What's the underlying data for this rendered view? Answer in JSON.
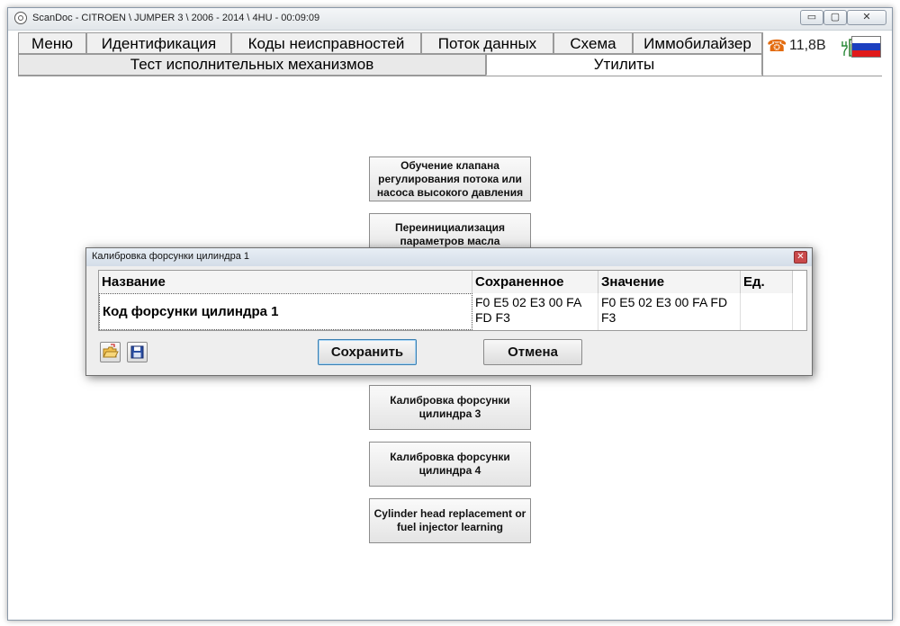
{
  "window": {
    "title": "ScanDoc - CITROEN \\ JUMPER 3 \\ 2006 - 2014 \\ 4HU - 00:09:09",
    "minimize": "▭",
    "maximize": "▢",
    "close": "✕"
  },
  "menu": [
    {
      "label": "Меню"
    },
    {
      "label": "Идентификация"
    },
    {
      "label": "Коды неисправностей"
    },
    {
      "label": "Поток данных"
    },
    {
      "label": "Схема"
    },
    {
      "label": "Иммобилайзер"
    }
  ],
  "sub_tabs": [
    {
      "label": "Тест исполнительных механизмов",
      "active": false
    },
    {
      "label": "Утилиты",
      "active": true
    }
  ],
  "status": {
    "phone_icon": "☎",
    "voltage": "11,8В",
    "battery_icon": "battery-charging-icon",
    "flag_icon": "russia-flag-icon",
    "flag_colors": [
      "#ffffff",
      "#1c3fbf",
      "#e01a1a"
    ]
  },
  "functions": [
    {
      "label": "Обучение клапана регулирования потока или насоса высокого давления"
    },
    {
      "label": "Переинициализация параметров масла"
    },
    {
      "label": "Калибровка форсунки цилиндра 3"
    },
    {
      "label": "Калибровка форсунки цилиндра 4"
    },
    {
      "label": "Cylinder head replacement or fuel injector learning"
    }
  ],
  "dialog": {
    "title": "Калибровка форсунки цилиндра 1",
    "close": "✕",
    "columns": [
      "Название",
      "Сохраненное",
      "Значение",
      "Ед."
    ],
    "rows": [
      {
        "name": "Код форсунки цилиндра 1",
        "saved": "F0 E5 02 E3 00 FA FD F3",
        "value": "F0 E5 02 E3 00 FA FD F3",
        "unit": ""
      }
    ],
    "save_label": "Сохранить",
    "cancel_label": "Отмена",
    "open_icon": "open-folder-icon",
    "save_icon": "floppy-disk-icon"
  },
  "colors": {
    "phone": "#e36b0f",
    "dialog_close": "#c9494b",
    "primary_button_border": "#3c7fb1"
  }
}
